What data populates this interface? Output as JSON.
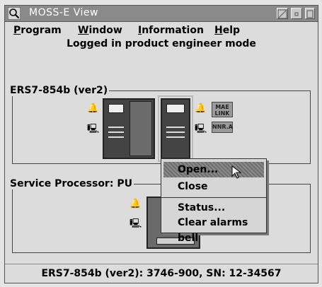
{
  "window": {
    "title": "MOSS-E View"
  },
  "menubar": {
    "items": [
      "Program",
      "Window",
      "Information",
      "Help"
    ]
  },
  "mode_text": "Logged in product engineer mode",
  "groups": {
    "ers7": {
      "label": "ERS7-854b (ver2)",
      "tags": [
        "MAE LINK",
        "NNR.A"
      ]
    },
    "service": {
      "label": "Service Processor: PU"
    }
  },
  "context_menu": {
    "items": [
      "Open...",
      "Close",
      "Status...",
      "Clear alarms bell"
    ],
    "selected": "Open..."
  },
  "status_bar": "ERS7-854b (ver2): 3746-900, SN: 12-34567",
  "icons": [
    "search-icon",
    "bell-icon",
    "computer-icon",
    "mouse-pointer-icon",
    "resize-icon",
    "minimize-icon",
    "maximize-icon"
  ]
}
